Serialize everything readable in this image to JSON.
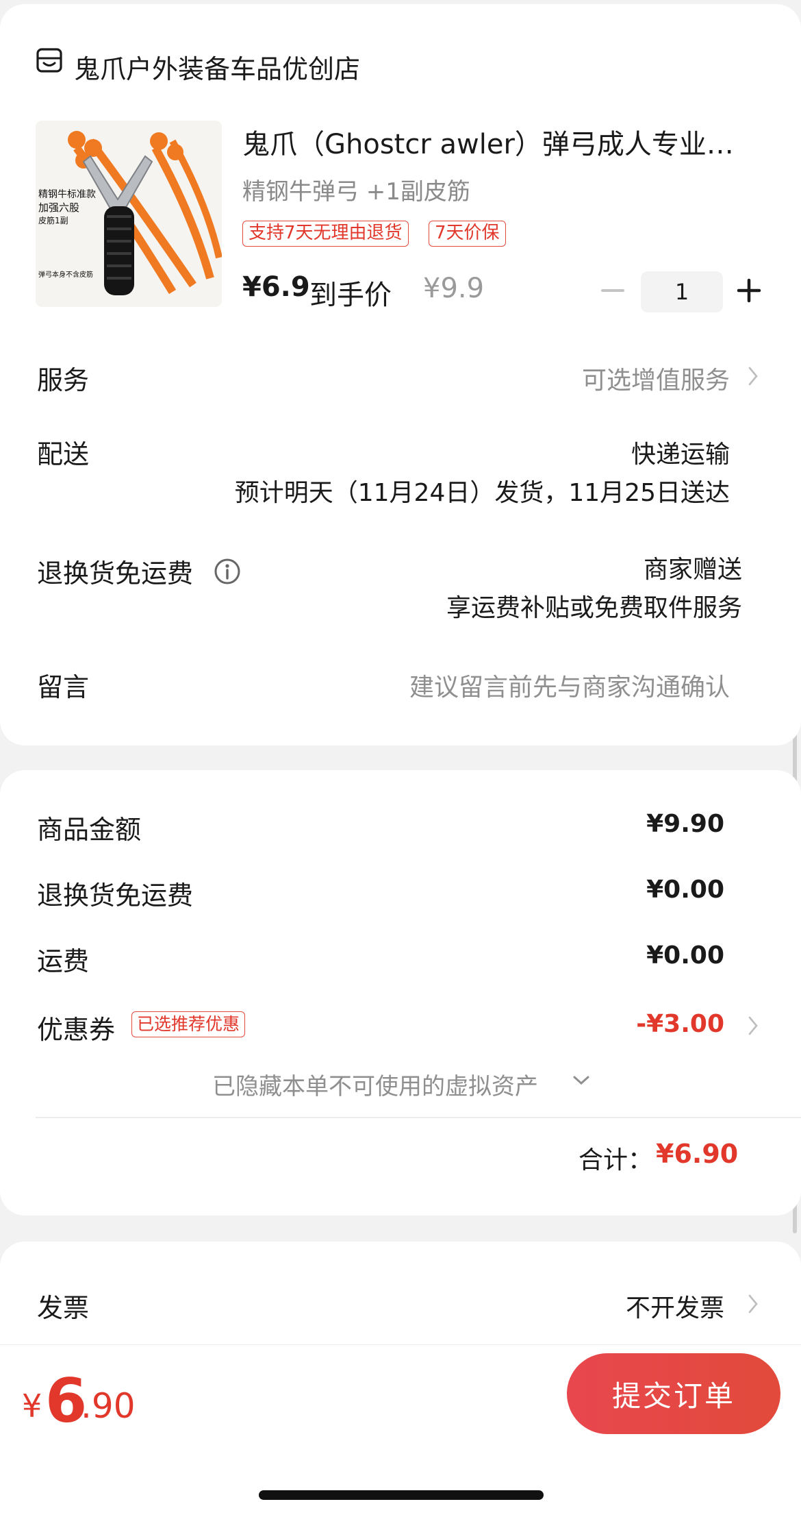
{
  "store": {
    "name": "鬼爪户外装备车品优创店"
  },
  "product": {
    "title": "鬼爪（Ghostcr awler）弹弓成人专业…",
    "spec": "精钢牛弹弓 +1副皮筋",
    "tags": [
      "支持7天无理由退货",
      "7天价保"
    ],
    "price_now": "¥6.9",
    "price_label": "到手价",
    "price_old": "¥9.9",
    "quantity": "1",
    "image_text": [
      "精钢牛标准款",
      "加强六股",
      "皮筋1副",
      "弹弓本身不含皮筋"
    ]
  },
  "rows": {
    "service": {
      "label": "服务",
      "value": "可选增值服务"
    },
    "delivery": {
      "label": "配送",
      "method": "快递运输",
      "eta": "预计明天（11月24日）发货，11月25日送达"
    },
    "return_shipping": {
      "label": "退换货免运费",
      "value": "商家赠送",
      "detail": "享运费补贴或免费取件服务"
    },
    "message": {
      "label": "留言",
      "placeholder": "建议留言前先与商家沟通确认"
    }
  },
  "amounts": {
    "goods": {
      "label": "商品金额",
      "value": "¥9.90"
    },
    "return_fee": {
      "label": "退换货免运费",
      "value": "¥0.00"
    },
    "shipping": {
      "label": "运费",
      "value": "¥0.00"
    },
    "coupon": {
      "label": "优惠券",
      "tag": "已选推荐优惠",
      "value": "-¥3.00"
    },
    "hidden_assets": "已隐藏本单不可使用的虚拟资产",
    "total_label": "合计：",
    "total_value": "¥6.90"
  },
  "invoice": {
    "label": "发票",
    "value": "不开发票"
  },
  "footer": {
    "pay_currency": "¥",
    "pay_integer": "6",
    "pay_decimal": ".90",
    "submit_label": "提交订单"
  },
  "colors": {
    "accent": "#e2382b",
    "muted": "#8f8f8f",
    "background": "#f2f2f2"
  }
}
